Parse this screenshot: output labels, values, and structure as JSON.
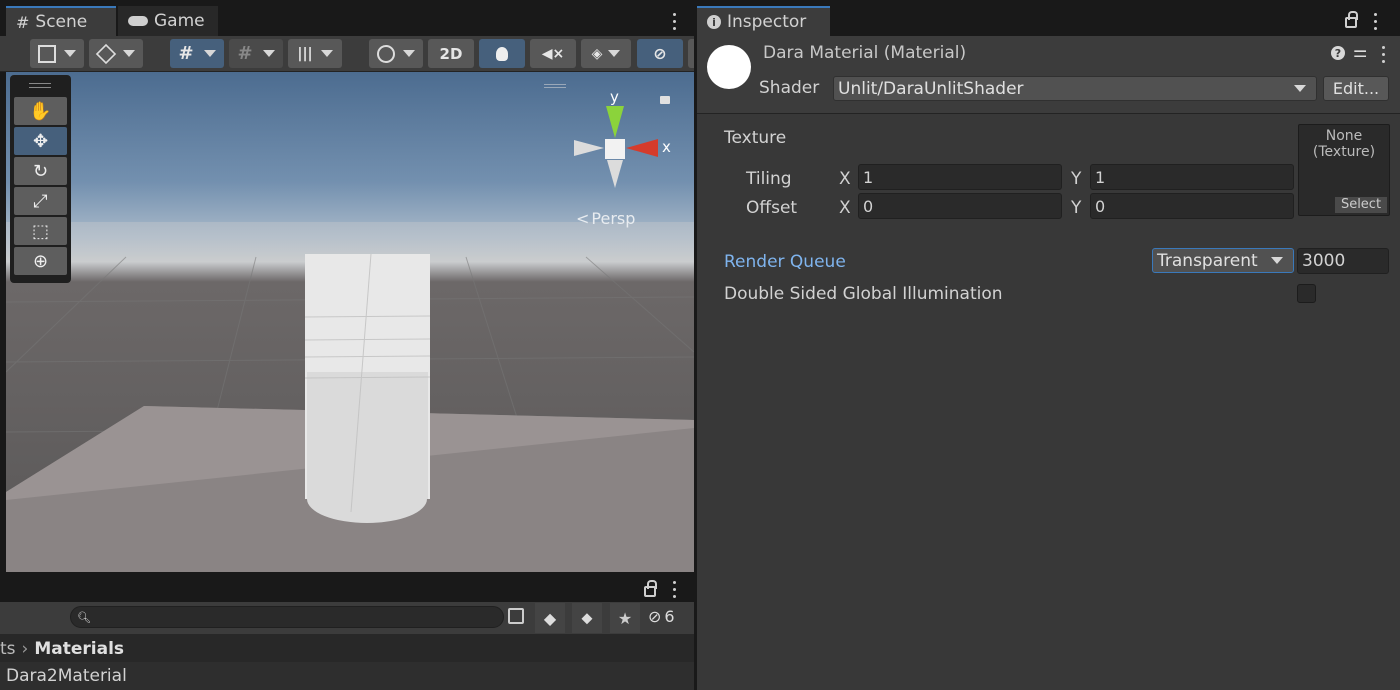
{
  "scene_panel": {
    "tabs": [
      {
        "label": "Scene",
        "icon": "grid-icon"
      },
      {
        "label": "Game",
        "icon": "gamepad-icon"
      }
    ],
    "toolbar": {
      "mode_2d_label": "2D"
    },
    "view": {
      "projection_label": "Persp",
      "axis_y_label": "y",
      "axis_x_label": "x"
    }
  },
  "project_panel": {
    "breadcrumb_prefix": "ts",
    "breadcrumb_current": "Materials",
    "search_placeholder": "",
    "hidden_count": "6",
    "items": [
      "Dara2Material"
    ]
  },
  "inspector": {
    "tab_label": "Inspector",
    "material_name": "Dara Material (Material)",
    "shader_label": "Shader",
    "shader_value": "Unlit/DaraUnlitShader",
    "edit_button": "Edit...",
    "texture_label": "Texture",
    "tiling_label": "Tiling",
    "offset_label": "Offset",
    "x_label": "X",
    "y_label": "Y",
    "tiling_x": "1",
    "tiling_y": "1",
    "offset_x": "0",
    "offset_y": "0",
    "texture_slot_line1": "None",
    "texture_slot_line2": "(Texture)",
    "texture_select_button": "Select",
    "render_queue_label": "Render Queue",
    "render_queue_mode": "Transparent",
    "render_queue_value": "3000",
    "double_sided_gi_label": "Double Sided Global Illumination",
    "double_sided_gi_checked": false,
    "help_icon_glyph": "?"
  },
  "colors": {
    "accent_blue": "#3a79bb",
    "link_blue": "#7fb4ee",
    "gizmo_x": "#d53b2b",
    "gizmo_y": "#8bd33b"
  }
}
